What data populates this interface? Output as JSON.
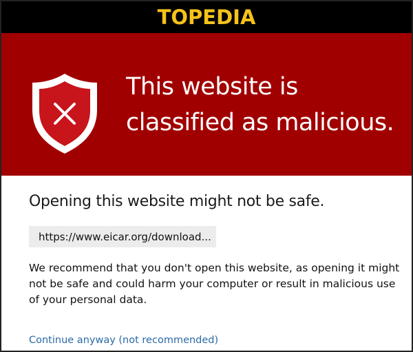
{
  "brand": {
    "logo_text": "TOPEDIA"
  },
  "warning": {
    "title": "This website is classified as malicious.",
    "icon": "shield-x-icon",
    "header_color": "#a10000"
  },
  "main": {
    "subheading": "Opening this website might not be safe.",
    "url": "https://www.eicar.org/download...",
    "recommendation": "We recommend that you don't open this website, as opening it might not be safe and could harm your computer or result in malicious use of your personal data.",
    "continue_link": "Continue anyway (not recommended)"
  }
}
